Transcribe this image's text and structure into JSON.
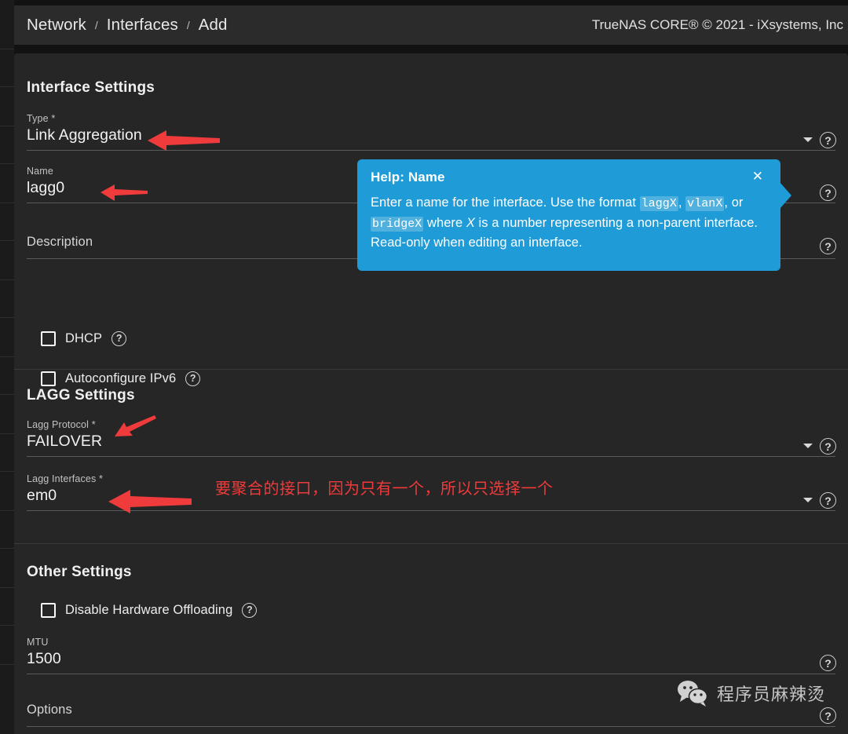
{
  "topbar": {
    "breadcrumb": [
      "Network",
      "Interfaces",
      "Add"
    ],
    "separator": "/",
    "copyright": "TrueNAS CORE® © 2021 - iXsystems, Inc"
  },
  "sections": {
    "interface_settings": {
      "title": "Interface Settings",
      "fields": [
        {
          "label": "Type *",
          "value": "Link Aggregation",
          "type": "select"
        },
        {
          "label": "Name",
          "value": "lagg0",
          "type": "text"
        },
        {
          "label": "Description",
          "value": "",
          "type": "text"
        }
      ],
      "checkboxes": [
        {
          "label": "DHCP",
          "checked": false
        },
        {
          "label": "Autoconfigure IPv6",
          "checked": false
        }
      ]
    },
    "lagg_settings": {
      "title": "LAGG Settings",
      "fields": [
        {
          "label": "Lagg Protocol *",
          "value": "FAILOVER",
          "type": "select"
        },
        {
          "label": "Lagg Interfaces *",
          "value": "em0",
          "type": "select"
        }
      ]
    },
    "other_settings": {
      "title": "Other Settings",
      "checkboxes": [
        {
          "label": "Disable Hardware Offloading",
          "checked": false
        }
      ],
      "fields": [
        {
          "label": "MTU",
          "value": "1500",
          "type": "text"
        },
        {
          "label": "Options",
          "value": "",
          "type": "text"
        }
      ]
    }
  },
  "tooltip": {
    "title": "Help: Name",
    "close_label": "✕",
    "body_part1": "Enter a name for the interface. Use the format ",
    "code1": "laggX",
    "body_sep1": ", ",
    "code2": "vlanX",
    "body_part2": ", or ",
    "code3": "bridgeX",
    "body_part3": " where ",
    "italic_x": "X",
    "body_part4": " is a number representing a non-parent interface. Read-only when editing an interface."
  },
  "annotations": {
    "chinese_note": "要聚合的接口，因为只有一个，所以只选择一个",
    "arrow_color": "#ef3b3b"
  },
  "watermark": {
    "text": "程序员麻辣烫"
  },
  "icons": {
    "help": "?",
    "caret": "▼"
  },
  "colors": {
    "accent": "#1f9bd7",
    "card_bg": "#262626",
    "page_bg": "#121212",
    "topbar_bg": "#2b2b2b",
    "annotation_red": "#ef3b3b"
  }
}
